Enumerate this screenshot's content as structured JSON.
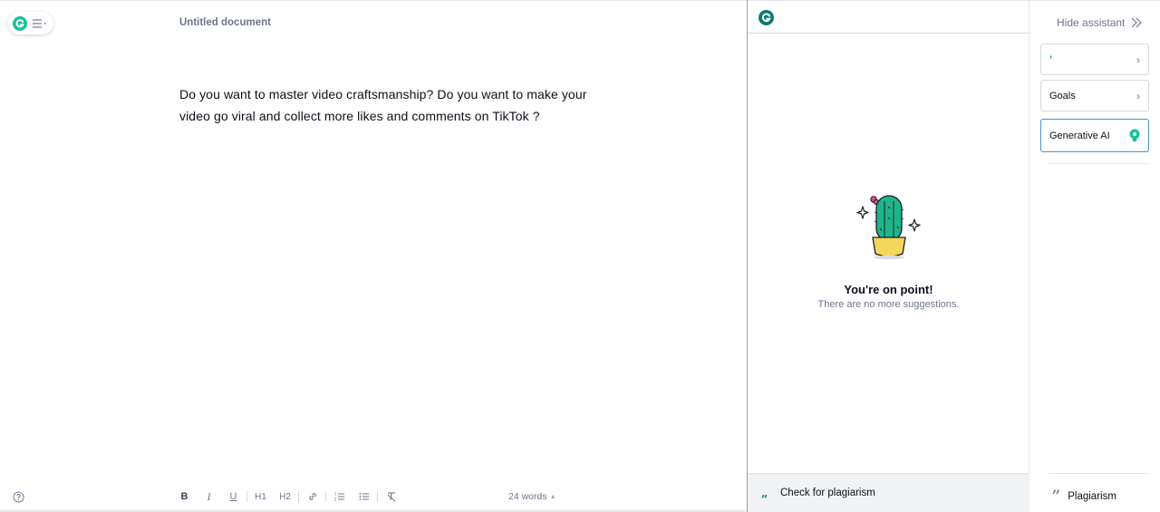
{
  "editor": {
    "title": "Untitled document",
    "body": "Do you want to master video craftsmanship? Do you want to make your video go viral and collect more likes and comments on TikTok ?",
    "word_count": "24 words",
    "toolbar": {
      "bold": "B",
      "italic": "I",
      "underline": "U",
      "h1": "H1",
      "h2": "H2"
    }
  },
  "assistant": {
    "empty_title": "You're on point!",
    "empty_subtitle": "There are no more suggestions.",
    "plagiarism_check_label": "Check for plagiarism",
    "quote_icon": "„"
  },
  "side_panel": {
    "hide_label": "Hide assistant",
    "first_card_label": "’",
    "goals_label": "Goals",
    "generative_ai_label": "Generative AI",
    "plagiarism_label": "Plagiarism"
  },
  "colors": {
    "brand": "#15c39a",
    "brand_dark": "#0a7c6e",
    "muted_text": "#6d758d",
    "active_border": "#4a90c2"
  },
  "icons": [
    "grammarly-logo-icon",
    "menu-icon",
    "help-icon",
    "link-icon",
    "ordered-list-icon",
    "bullet-list-icon",
    "clear-format-icon",
    "chevron-double-right-icon",
    "chevron-right-icon",
    "lightbulb-icon",
    "cactus-illustration",
    "quote-icon"
  ]
}
